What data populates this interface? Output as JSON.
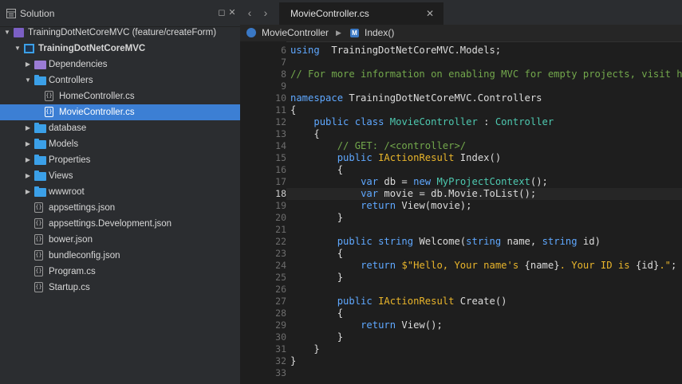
{
  "sidebar": {
    "title": "Solution",
    "tree": [
      {
        "label": "TrainingDotNetCoreMVC (feature/createForm)",
        "icon": "solution-icon",
        "arrow": "▼",
        "bold": false
      },
      {
        "label": "TrainingDotNetCoreMVC",
        "icon": "project-icon",
        "arrow": "▼",
        "bold": true
      },
      {
        "label": "Dependencies",
        "icon": "dependencies-icon",
        "arrow": "▶",
        "bold": false
      },
      {
        "label": "Controllers",
        "icon": "folder-icon",
        "arrow": "▼",
        "bold": false
      },
      {
        "label": "HomeController.cs",
        "icon": "file-icon",
        "arrow": "",
        "bold": false
      },
      {
        "label": "MovieController.cs",
        "icon": "file-icon",
        "arrow": "",
        "bold": false,
        "selected": true
      },
      {
        "label": "database",
        "icon": "folder-icon",
        "arrow": "▶",
        "bold": false
      },
      {
        "label": "Models",
        "icon": "folder-icon",
        "arrow": "▶",
        "bold": false
      },
      {
        "label": "Properties",
        "icon": "folder-icon",
        "arrow": "▶",
        "bold": false
      },
      {
        "label": "Views",
        "icon": "folder-icon",
        "arrow": "▶",
        "bold": false
      },
      {
        "label": "wwwroot",
        "icon": "folder-icon",
        "arrow": "▶",
        "bold": false
      },
      {
        "label": "appsettings.json",
        "icon": "file-icon",
        "arrow": "",
        "bold": false
      },
      {
        "label": "appsettings.Development.json",
        "icon": "file-icon",
        "arrow": "",
        "bold": false
      },
      {
        "label": "bower.json",
        "icon": "file-icon",
        "arrow": "",
        "bold": false
      },
      {
        "label": "bundleconfig.json",
        "icon": "file-icon",
        "arrow": "",
        "bold": false
      },
      {
        "label": "Program.cs",
        "icon": "file-icon",
        "arrow": "",
        "bold": false
      },
      {
        "label": "Startup.cs",
        "icon": "file-icon",
        "arrow": "",
        "bold": false
      }
    ]
  },
  "editor": {
    "tab_label": "MovieController.cs",
    "breadcrumb": {
      "class_name": "MovieController",
      "method_name": "Index()"
    },
    "active_line": 18,
    "lines": [
      {
        "n": 6,
        "segs": [
          [
            "k",
            "using"
          ],
          [
            "",
            "  TrainingDotNetCoreMVC.Models;"
          ]
        ]
      },
      {
        "n": 7,
        "segs": []
      },
      {
        "n": 8,
        "segs": [
          [
            "c",
            "// For more information on enabling MVC for empty projects, visit ht"
          ]
        ]
      },
      {
        "n": 9,
        "segs": []
      },
      {
        "n": 10,
        "segs": [
          [
            "k",
            "namespace"
          ],
          [
            "",
            " TrainingDotNetCoreMVC.Controllers"
          ]
        ]
      },
      {
        "n": 11,
        "segs": [
          [
            "",
            "{"
          ]
        ]
      },
      {
        "n": 12,
        "segs": [
          [
            "",
            "    "
          ],
          [
            "k",
            "public"
          ],
          [
            "",
            " "
          ],
          [
            "k",
            "class"
          ],
          [
            "",
            " "
          ],
          [
            "t",
            "MovieController"
          ],
          [
            "",
            " : "
          ],
          [
            "t",
            "Controller"
          ]
        ]
      },
      {
        "n": 13,
        "segs": [
          [
            "",
            "    {"
          ]
        ]
      },
      {
        "n": 14,
        "segs": [
          [
            "",
            "        "
          ],
          [
            "c",
            "// GET: /<controller>/"
          ]
        ]
      },
      {
        "n": 15,
        "segs": [
          [
            "",
            "        "
          ],
          [
            "k",
            "public"
          ],
          [
            "",
            " "
          ],
          [
            "s",
            "IActionResult"
          ],
          [
            "",
            " Index()"
          ]
        ]
      },
      {
        "n": 16,
        "segs": [
          [
            "",
            "        {"
          ]
        ]
      },
      {
        "n": 17,
        "segs": [
          [
            "",
            "            "
          ],
          [
            "k",
            "var"
          ],
          [
            "",
            " db = "
          ],
          [
            "k",
            "new"
          ],
          [
            "",
            " "
          ],
          [
            "t",
            "MyProjectContext"
          ],
          [
            "",
            "();"
          ]
        ]
      },
      {
        "n": 18,
        "segs": [
          [
            "",
            "            "
          ],
          [
            "k",
            "var"
          ],
          [
            "",
            " movie = db.Movie.ToList();"
          ]
        ]
      },
      {
        "n": 19,
        "segs": [
          [
            "",
            "            "
          ],
          [
            "k",
            "return"
          ],
          [
            "",
            " View(movie);"
          ]
        ]
      },
      {
        "n": 20,
        "segs": [
          [
            "",
            "        }"
          ]
        ]
      },
      {
        "n": 21,
        "segs": []
      },
      {
        "n": 22,
        "segs": [
          [
            "",
            "        "
          ],
          [
            "k",
            "public"
          ],
          [
            "",
            " "
          ],
          [
            "k",
            "string"
          ],
          [
            "",
            " Welcome("
          ],
          [
            "k",
            "string"
          ],
          [
            "",
            " name, "
          ],
          [
            "k",
            "string"
          ],
          [
            "",
            " id)"
          ]
        ]
      },
      {
        "n": 23,
        "segs": [
          [
            "",
            "        {"
          ]
        ]
      },
      {
        "n": 24,
        "segs": [
          [
            "",
            "            "
          ],
          [
            "k",
            "return"
          ],
          [
            "",
            " "
          ],
          [
            "s",
            "$\"Hello, Your name's "
          ],
          [
            "",
            "{name}"
          ],
          [
            "s",
            ". Your ID is "
          ],
          [
            "",
            "{id}"
          ],
          [
            "s",
            ".\""
          ],
          [
            "",
            ";"
          ]
        ]
      },
      {
        "n": 25,
        "segs": [
          [
            "",
            "        }"
          ]
        ]
      },
      {
        "n": 26,
        "segs": []
      },
      {
        "n": 27,
        "segs": [
          [
            "",
            "        "
          ],
          [
            "k",
            "public"
          ],
          [
            "",
            " "
          ],
          [
            "s",
            "IActionResult"
          ],
          [
            "",
            " Create()"
          ]
        ]
      },
      {
        "n": 28,
        "segs": [
          [
            "",
            "        {"
          ]
        ]
      },
      {
        "n": 29,
        "segs": [
          [
            "",
            "            "
          ],
          [
            "k",
            "return"
          ],
          [
            "",
            " View();"
          ]
        ]
      },
      {
        "n": 30,
        "segs": [
          [
            "",
            "        }"
          ]
        ]
      },
      {
        "n": 31,
        "segs": [
          [
            "",
            "    }"
          ]
        ]
      },
      {
        "n": 32,
        "segs": [
          [
            "",
            "}"
          ]
        ]
      },
      {
        "n": 33,
        "segs": []
      }
    ]
  }
}
